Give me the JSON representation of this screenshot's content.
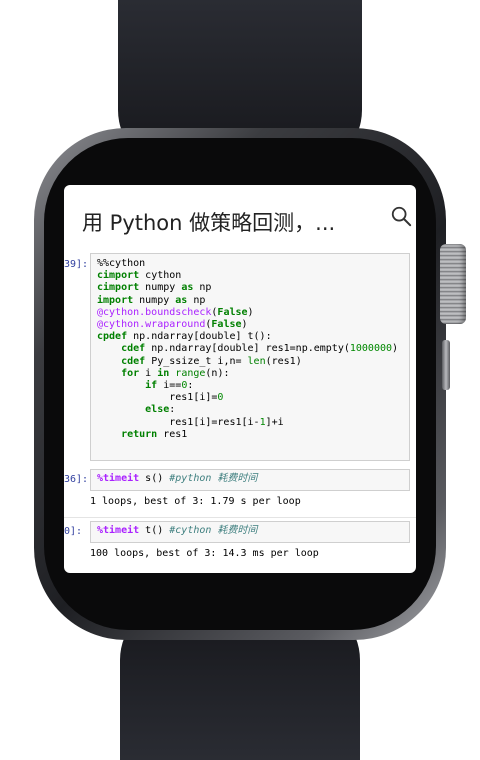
{
  "header": {
    "title": "用 Python 做策略回测，..."
  },
  "cells": [
    {
      "prompt": "39]:",
      "code_lines": [
        [
          {
            "t": "%%cython",
            "c": ""
          }
        ],
        [
          {
            "t": "cimport",
            "c": "kw"
          },
          {
            "t": " cython",
            "c": ""
          }
        ],
        [
          {
            "t": "cimport",
            "c": "kw"
          },
          {
            "t": " numpy ",
            "c": ""
          },
          {
            "t": "as",
            "c": "kw"
          },
          {
            "t": " np",
            "c": ""
          }
        ],
        [
          {
            "t": "import",
            "c": "kw"
          },
          {
            "t": " numpy ",
            "c": ""
          },
          {
            "t": "as",
            "c": "kw"
          },
          {
            "t": " np",
            "c": ""
          }
        ],
        [
          {
            "t": "@cython.boundscheck",
            "c": "dec"
          },
          {
            "t": "(",
            "c": ""
          },
          {
            "t": "False",
            "c": "kw"
          },
          {
            "t": ")",
            "c": ""
          }
        ],
        [
          {
            "t": "@cython.wraparound",
            "c": "dec"
          },
          {
            "t": "(",
            "c": ""
          },
          {
            "t": "False",
            "c": "kw"
          },
          {
            "t": ")",
            "c": ""
          }
        ],
        [
          {
            "t": "cpdef",
            "c": "kw"
          },
          {
            "t": " np.ndarray[double] t():",
            "c": ""
          }
        ],
        [
          {
            "t": "    cdef",
            "c": "kw"
          },
          {
            "t": " np.ndarray[double] res1=np.empty(",
            "c": ""
          },
          {
            "t": "1000000",
            "c": "num"
          },
          {
            "t": ")",
            "c": ""
          }
        ],
        [
          {
            "t": "    cdef",
            "c": "kw"
          },
          {
            "t": " Py_ssize_t i,n= ",
            "c": ""
          },
          {
            "t": "len",
            "c": "bi"
          },
          {
            "t": "(res1)",
            "c": ""
          }
        ],
        [
          {
            "t": "    for",
            "c": "kw"
          },
          {
            "t": " i ",
            "c": ""
          },
          {
            "t": "in",
            "c": "kw"
          },
          {
            "t": " ",
            "c": ""
          },
          {
            "t": "range",
            "c": "bi"
          },
          {
            "t": "(n):",
            "c": ""
          }
        ],
        [
          {
            "t": "        if",
            "c": "kw"
          },
          {
            "t": " i==",
            "c": ""
          },
          {
            "t": "0",
            "c": "num"
          },
          {
            "t": ":",
            "c": ""
          }
        ],
        [
          {
            "t": "            res1[i]=",
            "c": ""
          },
          {
            "t": "0",
            "c": "num"
          }
        ],
        [
          {
            "t": "        else",
            "c": "kw"
          },
          {
            "t": ":",
            "c": ""
          }
        ],
        [
          {
            "t": "            res1[i]=res1[i-",
            "c": ""
          },
          {
            "t": "1",
            "c": "num"
          },
          {
            "t": "]+i",
            "c": ""
          }
        ],
        [
          {
            "t": "    return",
            "c": "kw"
          },
          {
            "t": " res1",
            "c": ""
          }
        ]
      ]
    },
    {
      "prompt": "36]:",
      "code_lines": [
        [
          {
            "t": "%timeit",
            "c": "mg"
          },
          {
            "t": " s() ",
            "c": ""
          },
          {
            "t": "#python 耗费时间",
            "c": "cm"
          }
        ]
      ],
      "output": "1 loops, best of 3: 1.79 s per loop"
    },
    {
      "prompt": "0]:",
      "code_lines": [
        [
          {
            "t": "%timeit",
            "c": "mg"
          },
          {
            "t": " t() ",
            "c": ""
          },
          {
            "t": "#cython 耗费时间",
            "c": "cm"
          }
        ]
      ],
      "output": "100 loops, best of 3: 14.3 ms per loop"
    }
  ],
  "icons": {
    "search": "search-icon"
  },
  "colors": {
    "keyword": "#008000",
    "decorator": "#AA22FF",
    "number": "#008800",
    "comment": "#408080",
    "prompt": "#303F9F",
    "watch_band": "#1c1d22"
  }
}
